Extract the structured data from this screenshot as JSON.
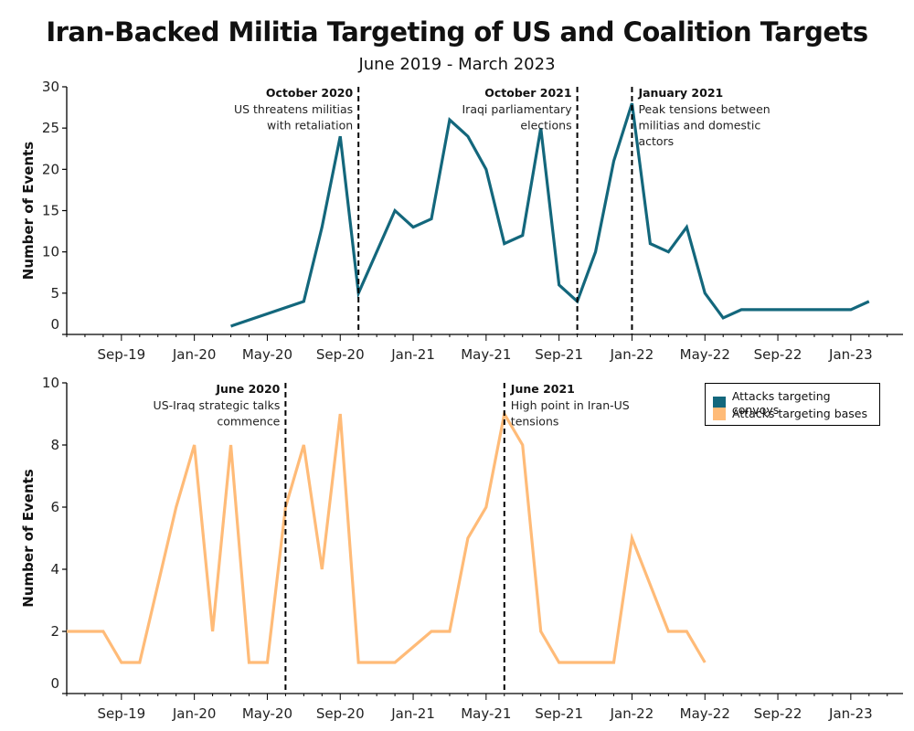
{
  "title": "Iran-Backed Militia Targeting of US and Coalition Targets",
  "subtitle": "June 2019 - March 2023",
  "colors": {
    "convoys": "#13677c",
    "bases": "#ffbb78",
    "axis": "#000000"
  },
  "chart_data": {
    "type": "line",
    "title": "Iran-Backed Militia Targeting of US and Coalition Targets",
    "subtitle": "June 2019 - March 2023",
    "x_start": "2019-06",
    "x_tick_labels": [
      "Sep-19",
      "Jan-20",
      "May-20",
      "Sep-20",
      "Jan-21",
      "May-21",
      "Sep-21",
      "Jan-22",
      "May-22",
      "Sep-22",
      "Jan-23"
    ],
    "months": [
      "Jun-19",
      "Jul-19",
      "Aug-19",
      "Sep-19",
      "Oct-19",
      "Nov-19",
      "Dec-19",
      "Jan-20",
      "Feb-20",
      "Mar-20",
      "Apr-20",
      "May-20",
      "Jun-20",
      "Jul-20",
      "Aug-20",
      "Sep-20",
      "Oct-20",
      "Nov-20",
      "Dec-20",
      "Jan-21",
      "Feb-21",
      "Mar-21",
      "Apr-21",
      "May-21",
      "Jun-21",
      "Jul-21",
      "Aug-21",
      "Sep-21",
      "Oct-21",
      "Nov-21",
      "Dec-21",
      "Jan-22",
      "Feb-22",
      "Mar-22",
      "Apr-22",
      "May-22",
      "Jun-22",
      "Jul-22",
      "Aug-22",
      "Sep-22",
      "Oct-22",
      "Nov-22",
      "Dec-22",
      "Jan-23",
      "Feb-23"
    ],
    "legend": {
      "placement": "top-right of lower panel",
      "entries": [
        "Attacks targeting convoys",
        "Attacks targeting bases"
      ]
    },
    "panels": [
      {
        "name": "convoys",
        "ylabel": "Number of Events",
        "ylim": [
          0,
          30
        ],
        "y_ticks": [
          0,
          5,
          10,
          15,
          20,
          25,
          30
        ],
        "series": [
          {
            "name": "Attacks targeting convoys",
            "values": [
              null,
              null,
              null,
              null,
              null,
              null,
              null,
              null,
              null,
              1,
              null,
              null,
              null,
              4,
              13,
              24,
              5,
              null,
              15,
              13,
              14,
              26,
              24,
              20,
              11,
              12,
              25,
              6,
              4,
              10,
              21,
              28,
              11,
              10,
              13,
              5,
              2,
              3,
              3,
              3,
              3,
              3,
              3,
              3,
              4
            ]
          }
        ],
        "annotations": [
          {
            "month": "Oct-20",
            "label": "October 2020",
            "text": [
              "US threatens militias",
              "with retaliation"
            ],
            "align": "left"
          },
          {
            "month": "Oct-21",
            "label": "October 2021",
            "text": [
              "Iraqi parliamentary",
              "elections"
            ],
            "align": "left"
          },
          {
            "month": "Jan-22",
            "label": "January 2021",
            "text": [
              "Peak tensions between",
              "militias and domestic",
              "actors"
            ],
            "align": "right"
          }
        ]
      },
      {
        "name": "bases",
        "ylabel": "Number of Events",
        "ylim": [
          0,
          10
        ],
        "y_ticks": [
          0,
          2,
          4,
          6,
          8,
          10
        ],
        "series": [
          {
            "name": "Attacks targeting bases",
            "values": [
              2,
              2,
              2,
              1,
              1,
              null,
              6,
              8,
              2,
              8,
              1,
              1,
              6,
              8,
              4,
              9,
              1,
              1,
              1,
              null,
              2,
              2,
              5,
              6,
              9,
              8,
              2,
              1,
              1,
              1,
              1,
              5,
              null,
              2,
              2,
              1
            ]
          }
        ],
        "annotations": [
          {
            "month": "Jun-20",
            "label": "June 2020",
            "text": [
              "US-Iraq strategic talks",
              "commence"
            ],
            "align": "left"
          },
          {
            "month": "Jun-21",
            "label": "June 2021",
            "text": [
              "High point in Iran-US",
              "tensions"
            ],
            "align": "right"
          }
        ]
      }
    ]
  }
}
